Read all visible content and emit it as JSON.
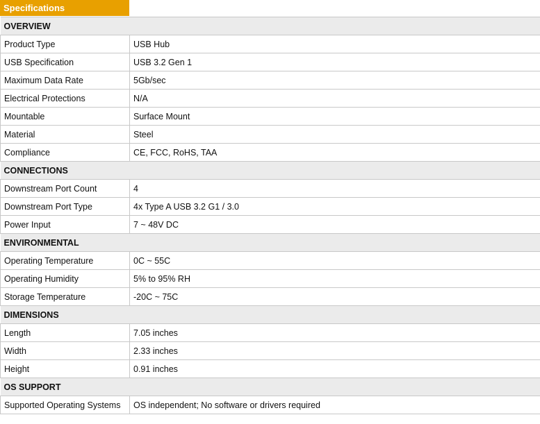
{
  "header": {
    "tab_label": "Specifications"
  },
  "sections": [
    {
      "title": "OVERVIEW",
      "rows": [
        {
          "label": "Product Type",
          "value": "USB Hub"
        },
        {
          "label": "USB Specification",
          "value": "USB 3.2 Gen 1"
        },
        {
          "label": "Maximum Data Rate",
          "value": "5Gb/sec"
        },
        {
          "label": "Electrical Protections",
          "value": "N/A"
        },
        {
          "label": "Mountable",
          "value": "Surface Mount"
        },
        {
          "label": "Material",
          "value": "Steel"
        },
        {
          "label": "Compliance",
          "value": "CE, FCC, RoHS, TAA"
        }
      ]
    },
    {
      "title": "CONNECTIONS",
      "rows": [
        {
          "label": "Downstream Port Count",
          "value": "4"
        },
        {
          "label": "Downstream Port Type",
          "value": "4x Type A USB 3.2 G1 / 3.0"
        },
        {
          "label": "Power Input",
          "value": "7 ~ 48V DC"
        }
      ]
    },
    {
      "title": "ENVIRONMENTAL",
      "rows": [
        {
          "label": "Operating Temperature",
          "value": "0C ~ 55C"
        },
        {
          "label": "Operating Humidity",
          "value": "5% to 95% RH"
        },
        {
          "label": "Storage Temperature",
          "value": "-20C ~ 75C"
        }
      ]
    },
    {
      "title": "DIMENSIONS",
      "rows": [
        {
          "label": "Length",
          "value": "7.05 inches"
        },
        {
          "label": "Width",
          "value": "2.33 inches"
        },
        {
          "label": "Height",
          "value": "0.91 inches"
        }
      ]
    },
    {
      "title": "OS SUPPORT",
      "rows": [
        {
          "label": "Supported Operating Systems",
          "value": "OS independent; No software or drivers required"
        }
      ]
    }
  ],
  "colors": {
    "tab_background": "#e8a000",
    "section_background": "#ebebeb",
    "border": "#c8c8c8"
  }
}
